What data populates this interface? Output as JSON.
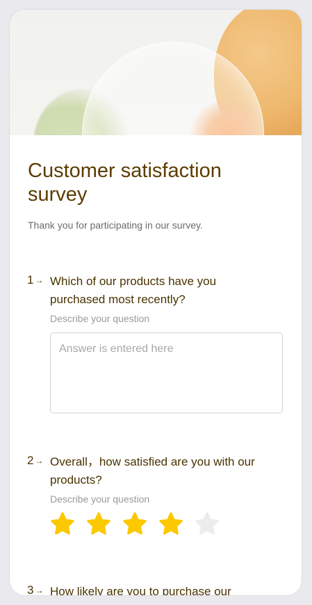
{
  "survey": {
    "title": "Customer satisfaction survey",
    "subtitle": "Thank you for participating in our survey."
  },
  "questions": [
    {
      "number": "1",
      "arrow": "→",
      "text": "Which of our products have you purchased most recently?",
      "description": "Describe your question",
      "answer_placeholder": "Answer is entered here"
    },
    {
      "number": "2",
      "arrow": "→",
      "text": "Overall，how satisfied are you with our products?",
      "description": "Describe your question",
      "rating": 4,
      "rating_max": 5
    },
    {
      "number": "3",
      "arrow": "→",
      "text": "How likely are you to purchase our"
    }
  ],
  "colors": {
    "title": "#5c3c00",
    "star_filled": "#fcc800",
    "star_empty": "#ececee"
  }
}
